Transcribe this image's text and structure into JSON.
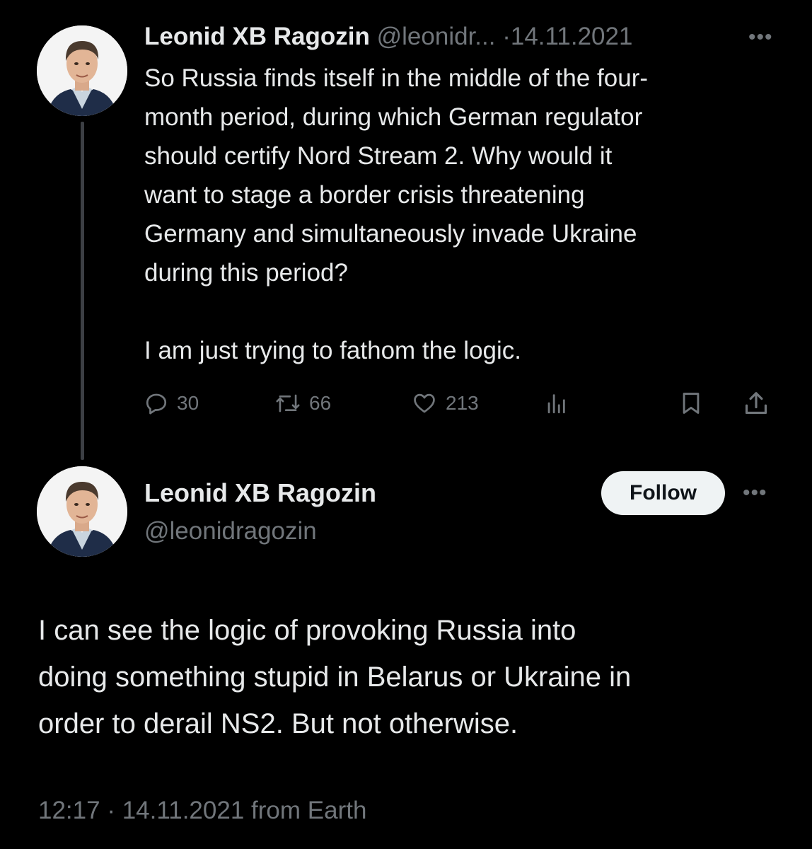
{
  "colors": {
    "background": "#000000",
    "text_primary": "#e7e9ea",
    "text_secondary": "#71767b",
    "follow_bg": "#eff3f4",
    "thread_line": "#3c3f44"
  },
  "parent_tweet": {
    "author_name": "Leonid XB Ragozin",
    "handle": "@leonidr...",
    "separator": "·",
    "date": "14.11.2021",
    "more_icon": "more-horizontal-icon",
    "text_line_1": "So Russia finds itself in the middle of the four-",
    "text_line_2": "month period, during which German regulator",
    "text_line_3": "should certify Nord Stream 2. Why would it",
    "text_line_4": "want to stage a border crisis threatening",
    "text_line_5": "Germany and simultaneously invade Ukraine",
    "text_line_6": "during this period?",
    "text_line_7": "I am just trying to fathom the logic.",
    "replies": "30",
    "retweets": "66",
    "likes": "213",
    "icons": {
      "reply": "reply-icon",
      "retweet": "retweet-icon",
      "like": "heart-icon",
      "views": "analytics-icon",
      "bookmark": "bookmark-icon",
      "share": "share-icon"
    }
  },
  "main_tweet": {
    "author_name": "Leonid XB Ragozin",
    "handle": "@leonidragozin",
    "follow_label": "Follow",
    "text_line_1": "I can see the logic of provoking Russia into",
    "text_line_2": "doing something stupid in Belarus or Ukraine in",
    "text_line_3": "order to derail NS2. But not otherwise.",
    "time": "12:17",
    "separator": "·",
    "date": "14.11.2021",
    "source_label": "from Earth"
  }
}
